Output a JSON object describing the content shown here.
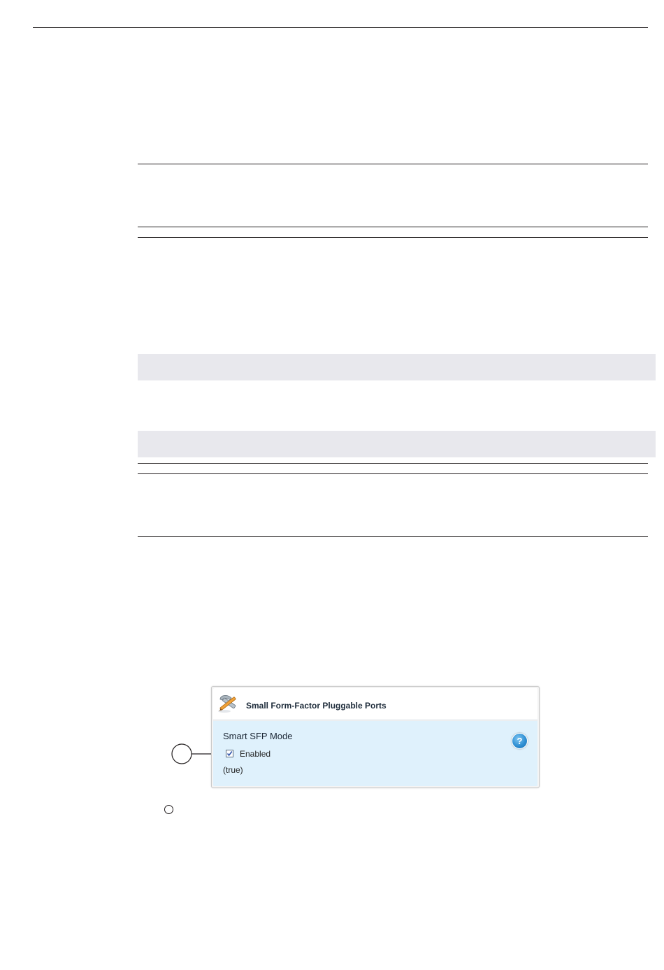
{
  "panel": {
    "title": "Small Form-Factor Pluggable Ports",
    "icon": "wrench-pencil-icon",
    "field_label": "Smart SFP Mode",
    "checkbox_label": "Enabled",
    "checkbox_checked": true,
    "value_text": "(true)",
    "help_icon": "question-icon",
    "help_symbol": "?",
    "body_color": "#dff1fc",
    "help_color": "#2f8fd3"
  }
}
